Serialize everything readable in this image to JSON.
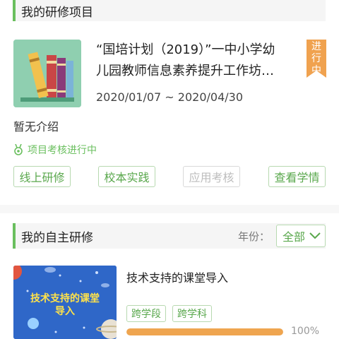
{
  "section1": {
    "title": "我的研修项目"
  },
  "project": {
    "title_line1": "“国培计划（2019）”一中小学幼",
    "title_line2": "儿园教师信息素养提升工作坊…",
    "dates": "2020/01/07 ~ 2020/04/30",
    "status": "进行中",
    "intro": "暂无介绍",
    "assessment": "项目考核进行中",
    "buttons": [
      {
        "label": "线上研修",
        "enabled": true
      },
      {
        "label": "校本实践",
        "enabled": true
      },
      {
        "label": "应用考核",
        "enabled": false
      },
      {
        "label": "查看学情",
        "enabled": true
      }
    ]
  },
  "section2": {
    "title": "我的自主研修",
    "year_label": "年份：",
    "year_value": "全部"
  },
  "course": {
    "thumb_text_line1": "技术支持的课堂",
    "thumb_text_line2": "导入",
    "title": "技术支持的课堂导入",
    "tags": [
      "跨学段",
      "跨学科"
    ],
    "progress": 1.0,
    "progress_text": "100%"
  },
  "colors": {
    "accent": "#6abf5e",
    "badge": "#f0a24f",
    "progress": "#efa54f",
    "thumb1_bg": "#8fcfb0",
    "thumb2_bg": "#2f67c8"
  }
}
